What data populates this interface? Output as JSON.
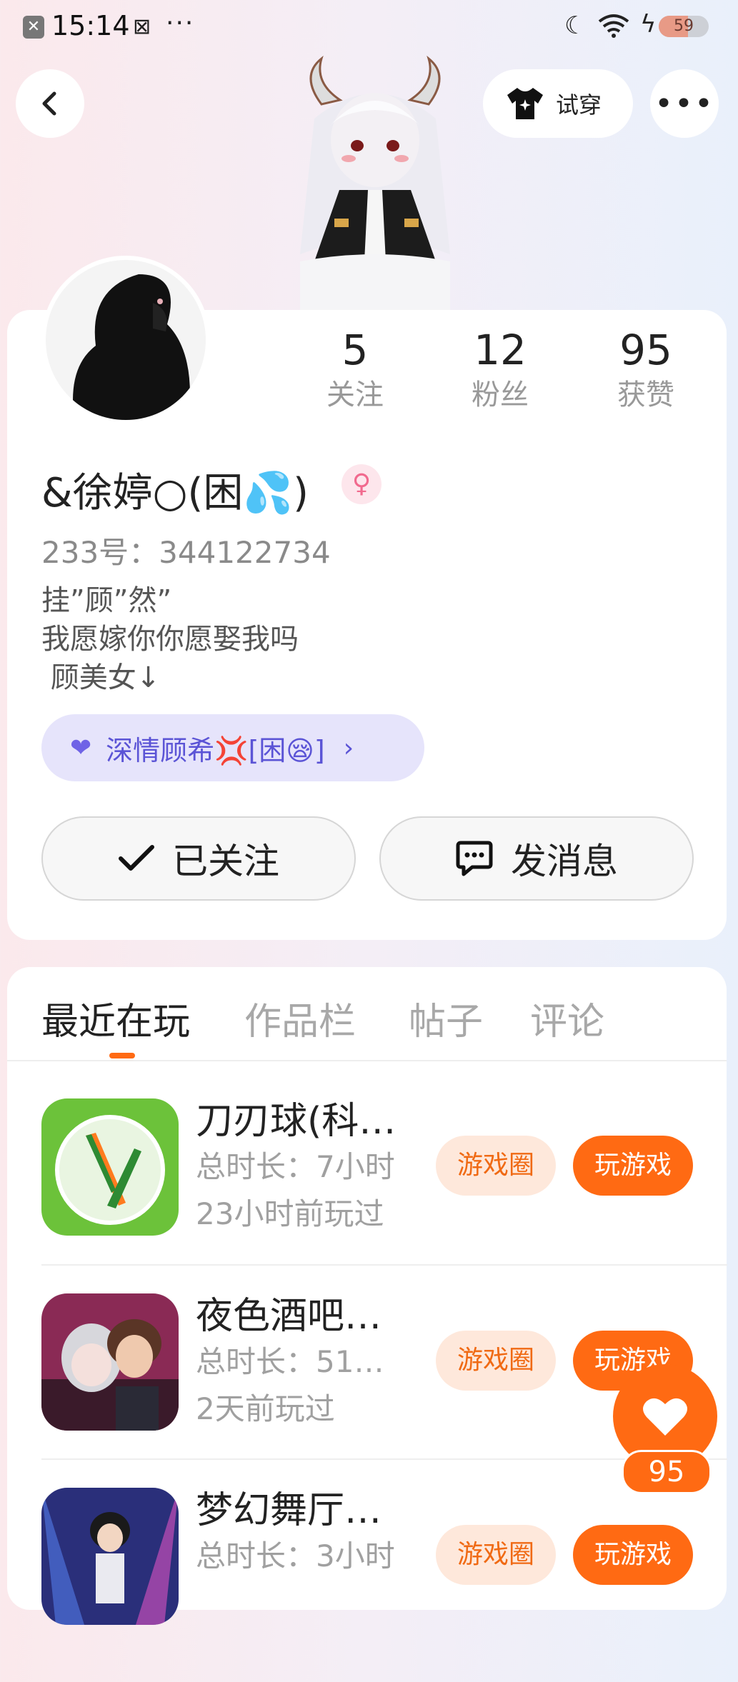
{
  "status_bar": {
    "time": "15:14",
    "battery": "59",
    "battery_level": 0.59
  },
  "top_bar": {
    "tryon_label": "试穿"
  },
  "profile": {
    "following_count": "5",
    "following_label": "关注",
    "fans_count": "12",
    "fans_label": "粉丝",
    "likes_count": "95",
    "likes_label": "获赞",
    "nickname": "&徐婷○(困💦)",
    "uid": "233号：344122734",
    "bio": "挂”顾”然”\n我愿嫁你你愿娶我吗\n 顾美女↓",
    "guild_tag": "深情顾希💢[困😪]",
    "followed_label": "已关注",
    "message_label": "发消息"
  },
  "tabs": [
    {
      "label": "最近在玩",
      "active": true
    },
    {
      "label": "作品栏",
      "active": false
    },
    {
      "label": "帖子",
      "active": false
    },
    {
      "label": "评论",
      "active": false
    }
  ],
  "games": [
    {
      "name": "刀刃球(科…",
      "duration": "总时长：7小时",
      "last_played": "23小时前玩过",
      "circle_label": "游戏圈",
      "play_label": "玩游戏"
    },
    {
      "name": "夜色酒吧…",
      "duration": "总时长：51…",
      "last_played": "2天前玩过",
      "circle_label": "游戏圈",
      "play_label": "玩游戏"
    },
    {
      "name": "梦幻舞厅…",
      "duration": "总时长：3小时",
      "last_played": "",
      "circle_label": "游戏圈",
      "play_label": "玩游戏"
    }
  ],
  "like_fab": {
    "count": "95"
  },
  "colors": {
    "accent": "#ff6a13",
    "guild": "#5b54d6"
  }
}
